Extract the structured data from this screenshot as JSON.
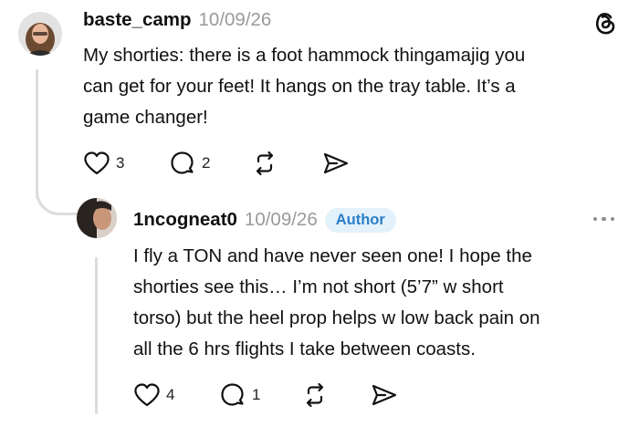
{
  "app": {
    "brand_icon": "threads-logo-icon",
    "accent_color": "#2a7fc7"
  },
  "post": {
    "username": "baste_camp",
    "timestamp": "10/09/26",
    "text_lines": [
      "My shorties: there is a foot hammock thingamajig you",
      "can get for your feet! It hangs on the tray table. It’s a",
      "game changer!"
    ],
    "likes": "3",
    "comments": "2"
  },
  "reply": {
    "username": "1ncogneat0",
    "timestamp": "10/09/26",
    "badge": "Author",
    "text_lines": [
      "I fly a TON and have never seen one! I hope the",
      "shorties see this… I’m not short (5’7” w short",
      "torso) but the heel prop helps w low back pain on",
      "all the 6 hrs flights I take between coasts."
    ],
    "likes": "4",
    "comments": "1"
  }
}
